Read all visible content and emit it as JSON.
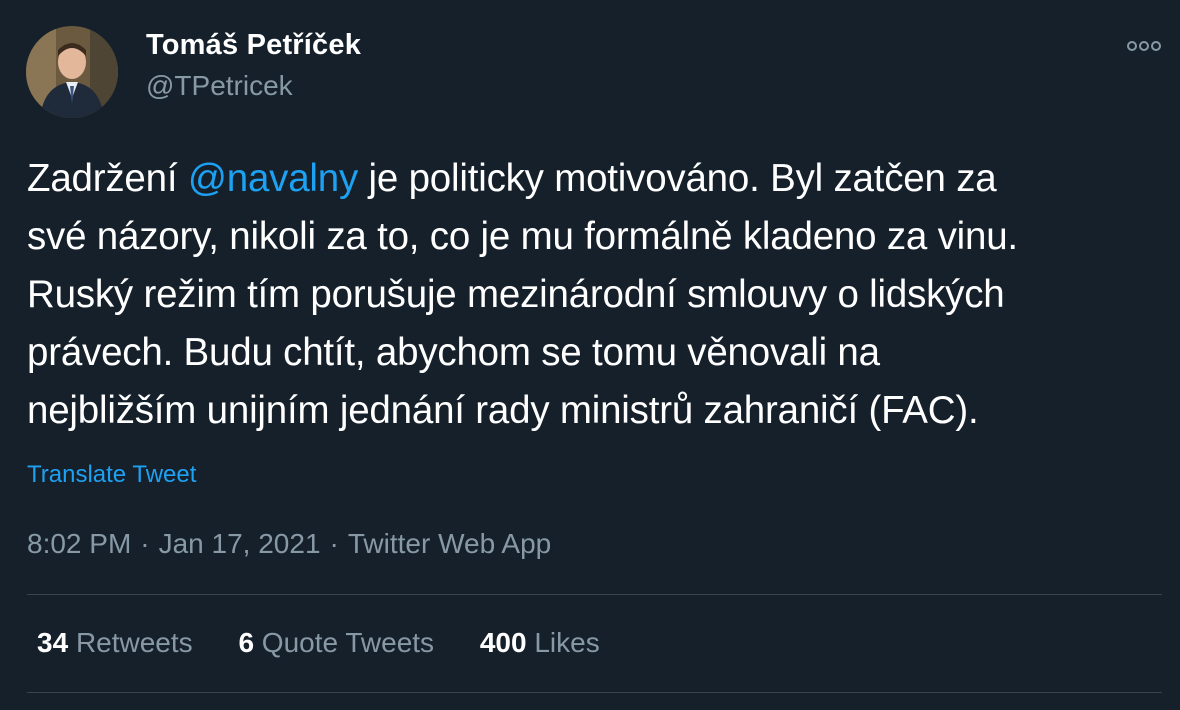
{
  "author": {
    "display_name": "Tomáš Petříček",
    "handle": "@TPetricek"
  },
  "tweet": {
    "lines": [
      {
        "before": "Zadržení ",
        "mention": "@navalny",
        "after": " je politicky motivováno. Byl zatčen za"
      },
      {
        "text": "své názory, nikoli za to, co je mu formálně kladeno za vinu."
      },
      {
        "text": "Ruský režim tím porušuje mezinárodní smlouvy o lidských"
      },
      {
        "text": "právech. Budu chtít, abychom se tomu věnovali na"
      },
      {
        "text": "nejbližším unijním jednání rady ministrů zahraničí (FAC)."
      }
    ],
    "translate_label": "Translate Tweet"
  },
  "meta": {
    "time": "8:02 PM",
    "separator": "·",
    "date": "Jan 17, 2021",
    "source": "Twitter Web App"
  },
  "stats": {
    "retweets_count": "34",
    "retweets_label": "Retweets",
    "quotes_count": "6",
    "quotes_label": "Quote Tweets",
    "likes_count": "400",
    "likes_label": "Likes"
  },
  "colors": {
    "background": "#15202b",
    "primary_text": "#ffffff",
    "secondary_text": "#8899a6",
    "accent": "#1da1f2",
    "divider": "#38444d"
  },
  "icons": {
    "more": "more-horizontal-icon"
  }
}
